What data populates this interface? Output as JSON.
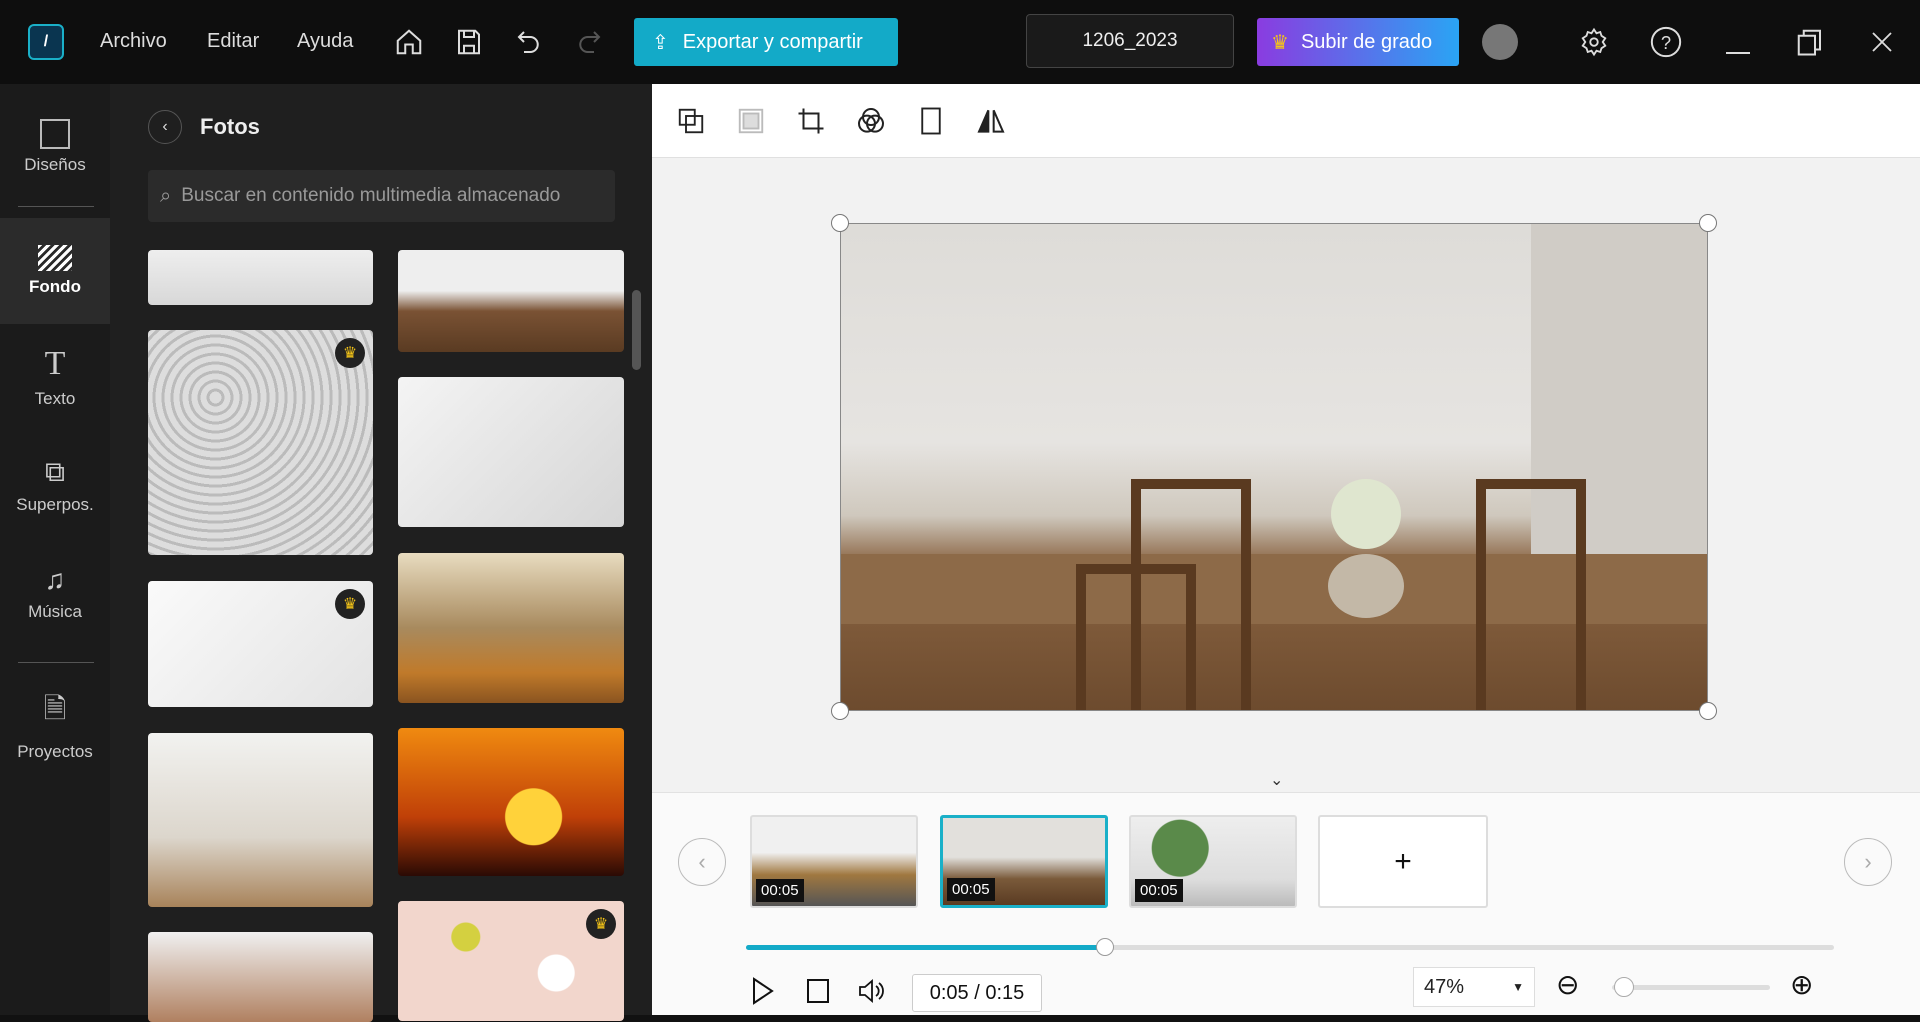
{
  "menu": {
    "items": [
      "Archivo",
      "Editar",
      "Ayuda"
    ]
  },
  "toolbar": {
    "export_label": "Exportar y compartir",
    "project_name": "1206_2023",
    "upgrade_label": "Subir de grado"
  },
  "rail": {
    "items": [
      {
        "label": "Diseños"
      },
      {
        "label": "Fondo",
        "active": true
      },
      {
        "label": "Texto"
      },
      {
        "label": "Superpos."
      },
      {
        "label": "Música"
      },
      {
        "label": "Proyectos"
      }
    ]
  },
  "panel": {
    "title": "Fotos",
    "search_placeholder": "Buscar en contenido multimedia almacenado"
  },
  "timeline": {
    "clips": [
      {
        "duration": "00:05"
      },
      {
        "duration": "00:05",
        "selected": true
      },
      {
        "duration": "00:05"
      }
    ],
    "add_label": "+",
    "progress": 0.33,
    "time": "0:05 / 0:15",
    "zoom": "47%"
  },
  "colors": {
    "accent": "#13aac8",
    "upgrade_start": "#8a3ce0",
    "upgrade_end": "#2aa4f4"
  }
}
